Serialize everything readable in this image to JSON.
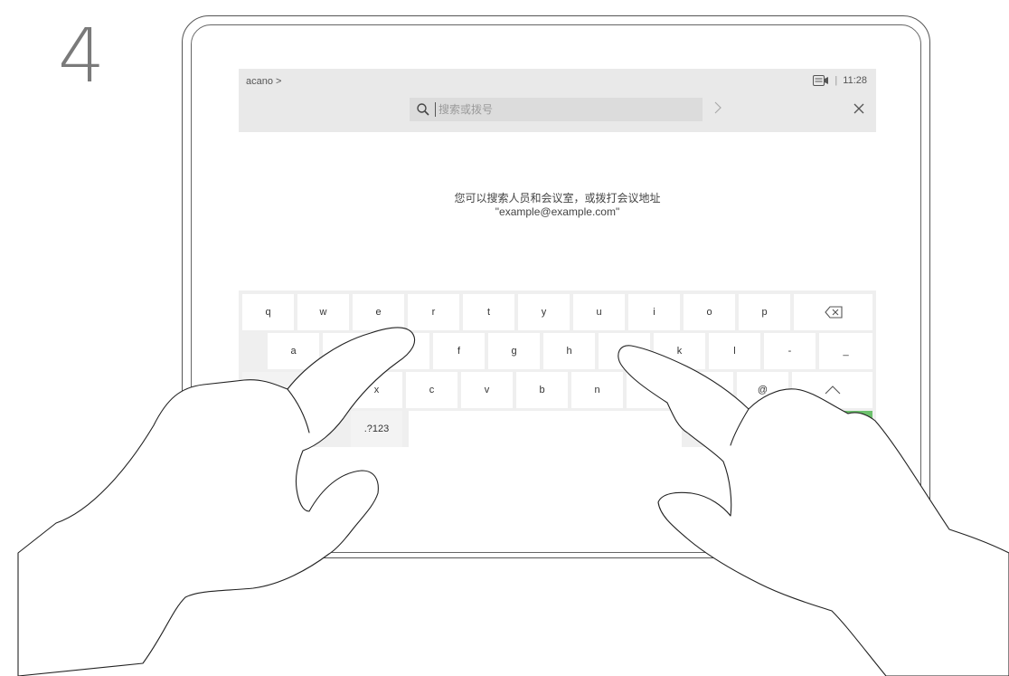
{
  "step": "4",
  "header": {
    "breadcrumb": "acano >",
    "time": "11:28",
    "status_separator": "|"
  },
  "search": {
    "placeholder": "搜索或拨号",
    "value": ""
  },
  "hint": {
    "line1": "您可以搜索人员和会议室，或拨打会议地址",
    "line2": "\"example@example.com\""
  },
  "keyboard": {
    "row1": [
      "q",
      "w",
      "e",
      "r",
      "t",
      "y",
      "u",
      "i",
      "o",
      "p"
    ],
    "row2": [
      "a",
      "",
      "",
      "f",
      "g",
      "h",
      "",
      "k",
      "l",
      "-",
      "_"
    ],
    "row3": [
      "",
      "",
      "x",
      "c",
      "v",
      "b",
      "n",
      "",
      "",
      "@"
    ],
    "row4_symbols_key": ".?123"
  },
  "colors": {
    "enter_key": "#6dc16d",
    "topbar": "#e9e9e9",
    "keyboard_bg": "#efefef"
  },
  "icons": [
    "search-icon",
    "chevron-right-icon",
    "close-icon",
    "camera-icon",
    "backspace-icon",
    "shift-caret-icon"
  ]
}
